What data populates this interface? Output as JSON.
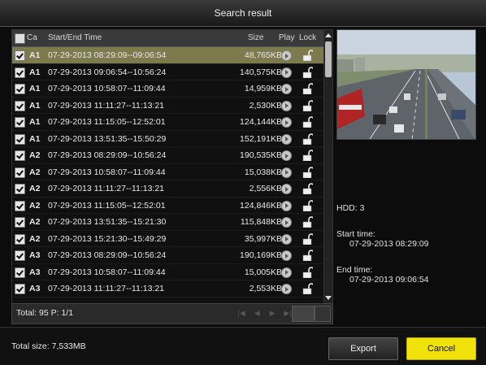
{
  "title": "Search result",
  "table": {
    "headers": {
      "ch": "Ca",
      "time": "Start/End Time",
      "size": "Size",
      "play": "Play",
      "lock": "Lock"
    },
    "rows": [
      {
        "ch": "A1",
        "time": "07-29-2013 08:29:09--09:06:54",
        "size": "48,765KB",
        "selected": true
      },
      {
        "ch": "A1",
        "time": "07-29-2013 09:06:54--10:56:24",
        "size": "140,575KB"
      },
      {
        "ch": "A1",
        "time": "07-29-2013 10:58:07--11:09:44",
        "size": "14,959KB"
      },
      {
        "ch": "A1",
        "time": "07-29-2013 11:11:27--11:13:21",
        "size": "2,530KB"
      },
      {
        "ch": "A1",
        "time": "07-29-2013 11:15:05--12:52:01",
        "size": "124,144KB"
      },
      {
        "ch": "A1",
        "time": "07-29-2013 13:51:35--15:50:29",
        "size": "152,191KB"
      },
      {
        "ch": "A2",
        "time": "07-29-2013 08:29:09--10:56:24",
        "size": "190,535KB"
      },
      {
        "ch": "A2",
        "time": "07-29-2013 10:58:07--11:09:44",
        "size": "15,038KB"
      },
      {
        "ch": "A2",
        "time": "07-29-2013 11:11:27--11:13:21",
        "size": "2,556KB"
      },
      {
        "ch": "A2",
        "time": "07-29-2013 11:15:05--12:52:01",
        "size": "124,846KB"
      },
      {
        "ch": "A2",
        "time": "07-29-2013 13:51:35--15:21:30",
        "size": "115,848KB"
      },
      {
        "ch": "A2",
        "time": "07-29-2013 15:21:30--15:49:29",
        "size": "35,997KB"
      },
      {
        "ch": "A3",
        "time": "07-29-2013 08:29:09--10:56:24",
        "size": "190,169KB"
      },
      {
        "ch": "A3",
        "time": "07-29-2013 10:58:07--11:09:44",
        "size": "15,005KB"
      },
      {
        "ch": "A3",
        "time": "07-29-2013 11:11:27--11:13:21",
        "size": "2,553KB"
      }
    ]
  },
  "footer": {
    "total": "Total: 95  P: 1/1"
  },
  "info": {
    "hdd": "HDD: 3",
    "start_label": "Start time:",
    "start_value": "07-29-2013 08:29:09",
    "end_label": "End time:",
    "end_value": "07-29-2013 09:06:54"
  },
  "bottom": {
    "total_size": "Total size: 7,533MB",
    "export": "Export",
    "cancel": "Cancel"
  },
  "icons": {
    "play": "play-icon",
    "lock": "unlock-icon",
    "scroll_up": "scroll-up-icon",
    "scroll_down": "scroll-down-icon"
  },
  "colors": {
    "selected_row": "#7d7b4d",
    "cancel_button": "#f0e20a"
  }
}
